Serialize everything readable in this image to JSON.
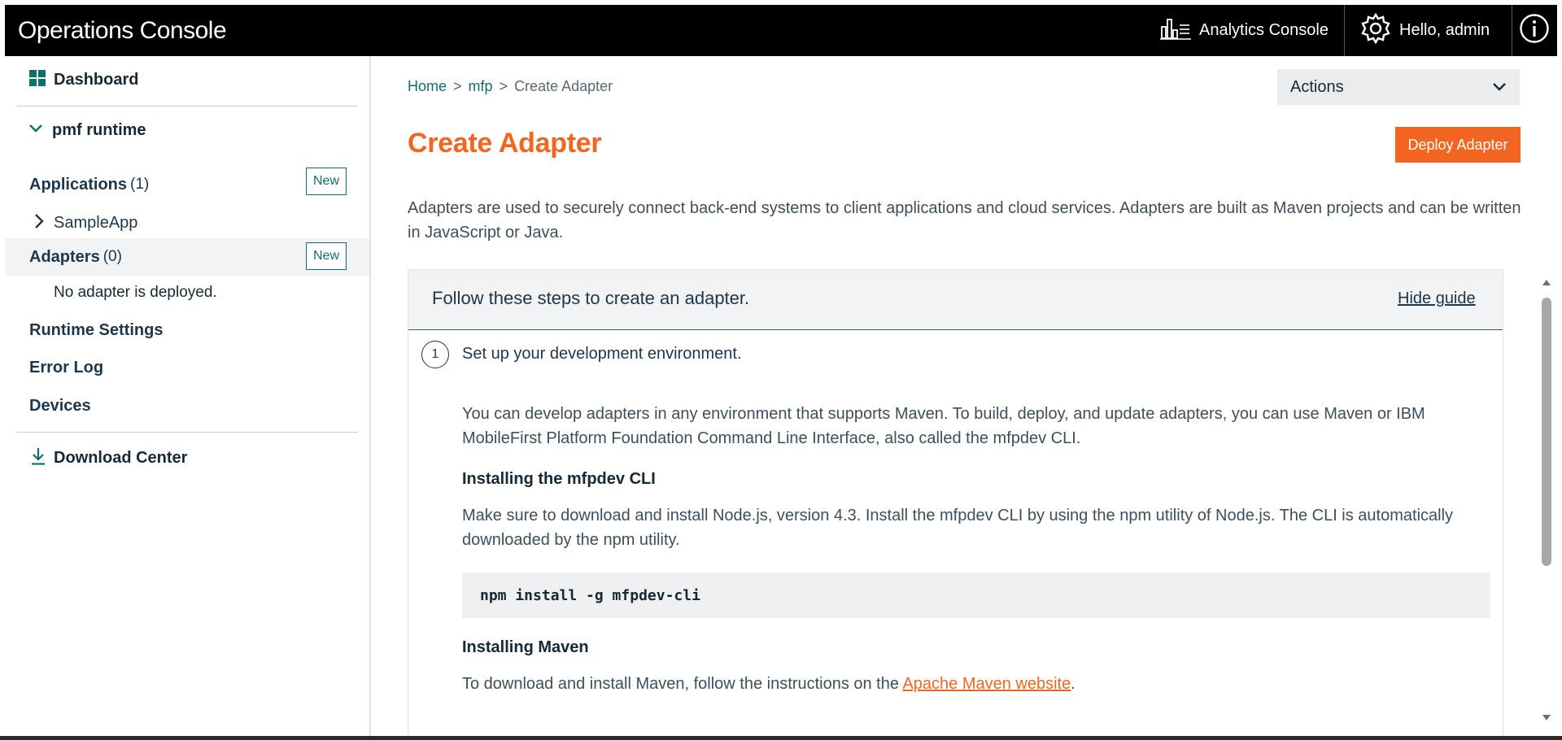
{
  "header": {
    "brand": "Operations Console",
    "analytics_label": "Analytics Console",
    "user_label": "Hello, admin"
  },
  "sidebar": {
    "dashboard": "Dashboard",
    "runtime": "pmf runtime",
    "applications": {
      "label": "Applications",
      "count": "(1)",
      "new_label": "New"
    },
    "sample_app": "SampleApp",
    "adapters": {
      "label": "Adapters",
      "count": "(0)",
      "new_label": "New"
    },
    "no_adapter": "No adapter is deployed.",
    "runtime_settings": "Runtime Settings",
    "error_log": "Error Log",
    "devices": "Devices",
    "download_center": "Download Center"
  },
  "breadcrumb": {
    "home": "Home",
    "sep": ">",
    "mfp": "mfp",
    "current": "Create Adapter"
  },
  "actions_label": "Actions",
  "page": {
    "title": "Create Adapter",
    "deploy_label": "Deploy Adapter",
    "intro": "Adapters are used to securely connect back-end systems to client applications and cloud services. Adapters are built as Maven projects and can be written in JavaScript or Java."
  },
  "guide": {
    "title": "Follow these steps to create an adapter.",
    "hide_label": "Hide guide",
    "step_number": "1",
    "step_title": "Set up your development environment.",
    "para1": "You can develop adapters in any environment that supports Maven. To build, deploy, and update adapters, you can use Maven or IBM MobileFirst Platform Foundation Command Line Interface, also called the mfpdev CLI.",
    "heading_cli": "Installing the mfpdev CLI",
    "para2": "Make sure to download and install Node.js, version 4.3. Install the mfpdev CLI by using the npm utility of Node.js. The CLI is automatically downloaded by the npm utility.",
    "code": "npm install -g mfpdev-cli",
    "heading_maven": "Installing Maven",
    "para3_prefix": "To download and install Maven, follow the instructions on the ",
    "para3_link": "Apache Maven website",
    "para3_suffix": "."
  },
  "colors": {
    "accent": "#f26622",
    "teal": "#0f6e6e",
    "topbar": "#000000"
  },
  "icons": [
    "bar-chart-icon",
    "gear-icon",
    "info-icon",
    "grid-icon",
    "chevron-down-icon",
    "chevron-right-icon",
    "download-icon"
  ]
}
